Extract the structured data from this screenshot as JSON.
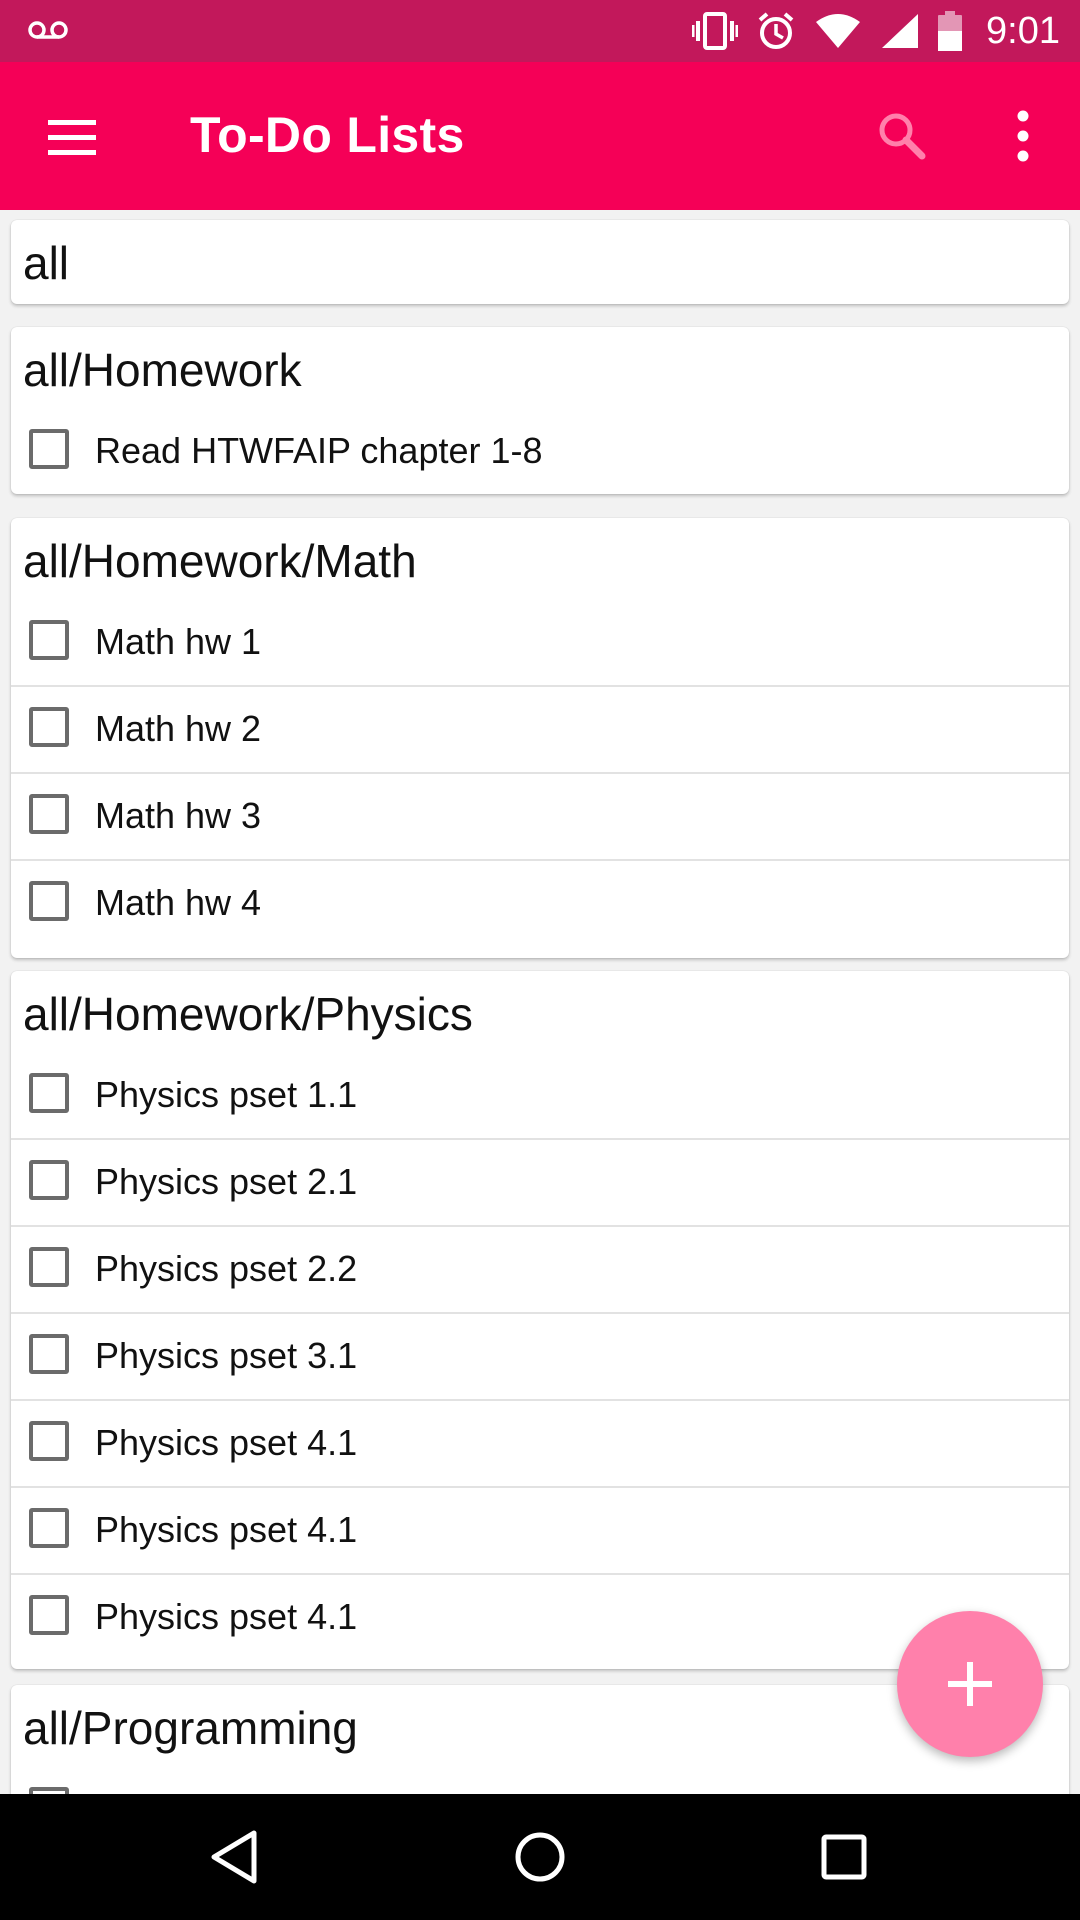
{
  "status_bar": {
    "time": "9:01",
    "icons": [
      "voicemail-icon",
      "vibrate-icon",
      "alarm-icon",
      "wifi-icon",
      "signal-icon",
      "battery-icon"
    ]
  },
  "app_bar": {
    "title": "To-Do Lists",
    "icons": [
      "menu-icon",
      "search-icon",
      "more-vert-icon"
    ]
  },
  "colors": {
    "status_bar": "#c2185b",
    "app_bar": "#f50057",
    "fab": "#ff80ab",
    "nav_bar": "#000000"
  },
  "lists": [
    {
      "title": "all",
      "items": []
    },
    {
      "title": "all/Homework",
      "items": [
        "Read HTWFAIP chapter 1-8"
      ]
    },
    {
      "title": "all/Homework/Math",
      "items": [
        "Math hw 1",
        "Math hw 2",
        "Math hw 3",
        "Math hw 4"
      ]
    },
    {
      "title": "all/Homework/Physics",
      "items": [
        "Physics pset 1.1",
        "Physics pset 2.1",
        "Physics pset 2.2",
        "Physics pset 3.1",
        "Physics pset 4.1",
        "Physics pset 4.1",
        "Physics pset 4.1"
      ]
    },
    {
      "title": "all/Programming",
      "items": [
        ""
      ]
    }
  ],
  "fab": {
    "icon": "add-icon"
  },
  "nav_bar": {
    "icons": [
      "back-icon",
      "home-icon",
      "recents-icon"
    ]
  }
}
